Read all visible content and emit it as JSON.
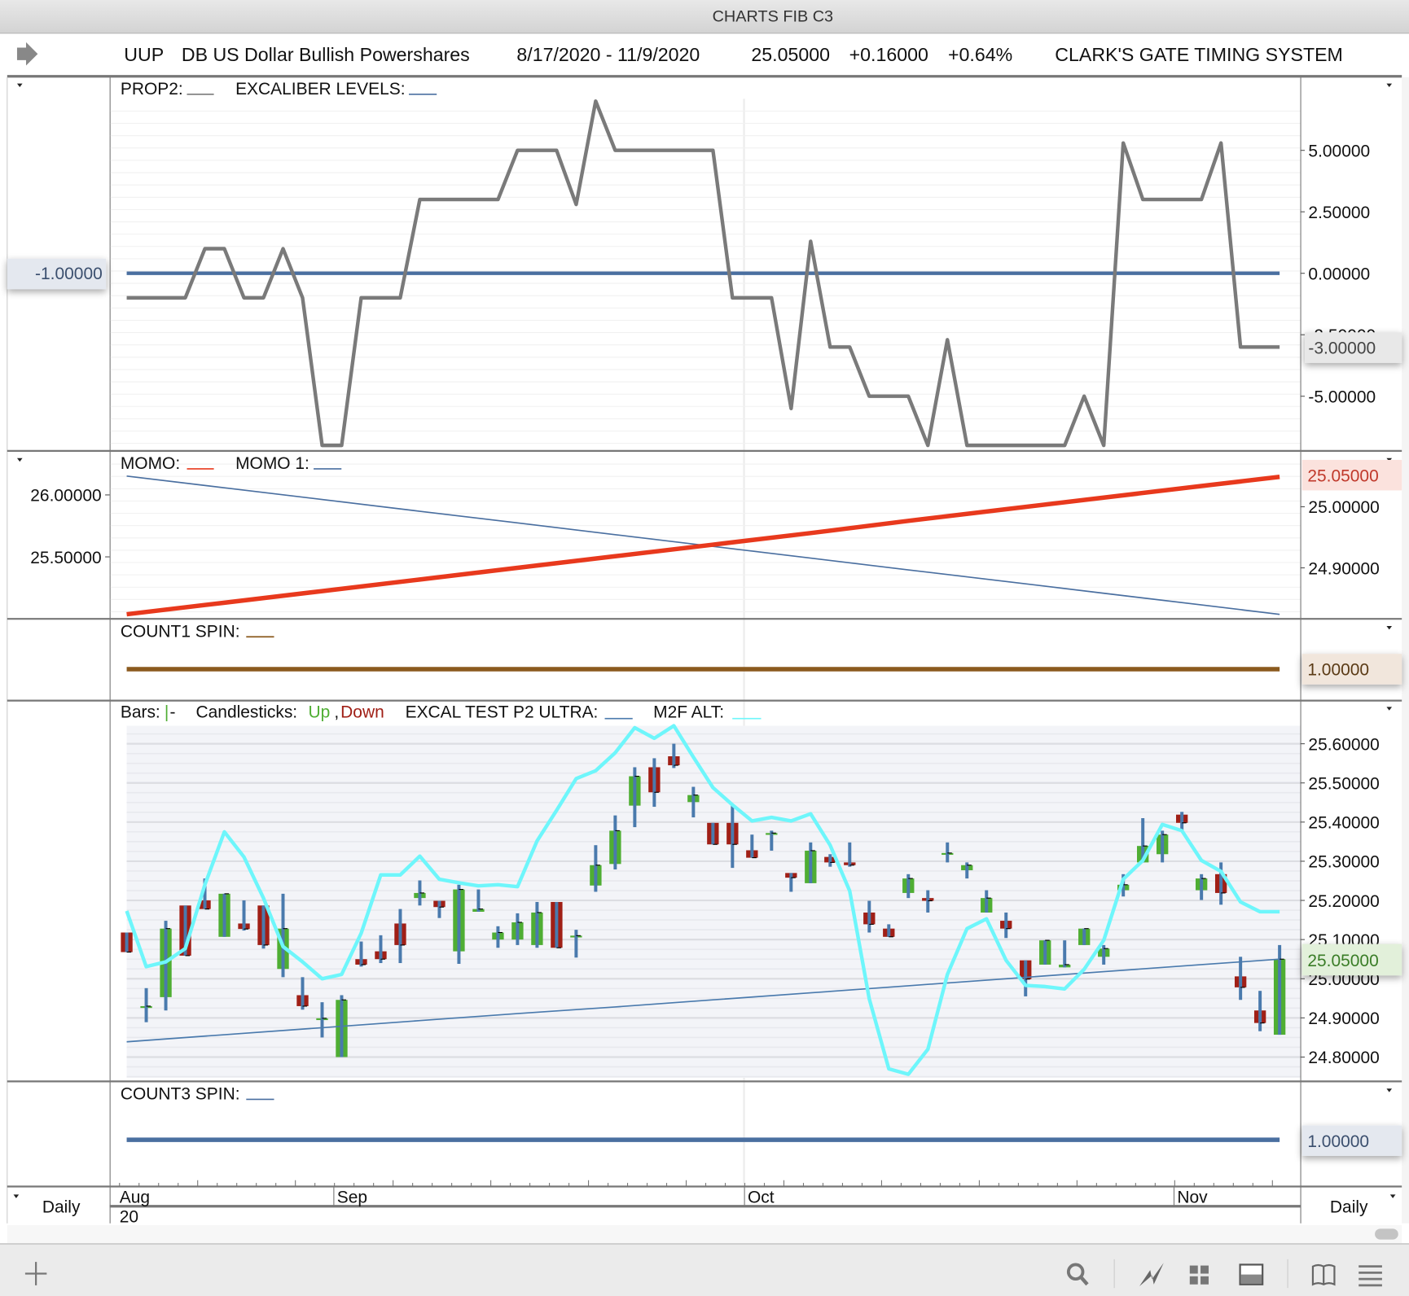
{
  "window": {
    "title": "CHARTS FIB C3"
  },
  "header": {
    "icon": "arrow-right-icon",
    "symbol": "UUP",
    "name": "DB US Dollar Bullish Powershares",
    "date_range": "8/17/2020 - 11/9/2020",
    "last": "25.05000",
    "change": "+0.16000",
    "change_pct": "+0.64%",
    "system": "CLARK'S GATE TIMING SYSTEM"
  },
  "time_axis": {
    "period_left": "Daily",
    "period_right": "Daily",
    "months": [
      "Aug",
      "Sep",
      "Oct",
      "Nov"
    ],
    "year": "20"
  },
  "toolbar": {
    "icons": [
      "add-icon",
      "search-icon",
      "chart-line-icon",
      "grid-icon",
      "panel-icon",
      "book-icon",
      "menu-icon"
    ]
  },
  "colors": {
    "up": "#4fae33",
    "down": "#a01f16",
    "bar": "#4a7aad",
    "prop2": "#7a7a7a",
    "excaliber": "#4a6fa0",
    "momo": "#e8391d",
    "momo1": "#4a6fa0",
    "count1": "#8b5a1e",
    "count3": "#4a6fa0",
    "m2f": "#6ef6fb",
    "excal_test": "#4a7aad"
  },
  "dates": [
    "2020-08-17",
    "2020-08-18",
    "2020-08-19",
    "2020-08-20",
    "2020-08-21",
    "2020-08-24",
    "2020-08-25",
    "2020-08-26",
    "2020-08-27",
    "2020-08-28",
    "2020-08-31",
    "2020-09-01",
    "2020-09-02",
    "2020-09-03",
    "2020-09-04",
    "2020-09-08",
    "2020-09-09",
    "2020-09-10",
    "2020-09-11",
    "2020-09-14",
    "2020-09-15",
    "2020-09-16",
    "2020-09-17",
    "2020-09-18",
    "2020-09-21",
    "2020-09-22",
    "2020-09-23",
    "2020-09-24",
    "2020-09-25",
    "2020-09-28",
    "2020-09-29",
    "2020-09-30",
    "2020-10-01",
    "2020-10-02",
    "2020-10-05",
    "2020-10-06",
    "2020-10-07",
    "2020-10-08",
    "2020-10-09",
    "2020-10-12",
    "2020-10-13",
    "2020-10-14",
    "2020-10-15",
    "2020-10-16",
    "2020-10-19",
    "2020-10-20",
    "2020-10-21",
    "2020-10-22",
    "2020-10-23",
    "2020-10-26",
    "2020-10-27",
    "2020-10-28",
    "2020-10-29",
    "2020-10-30",
    "2020-11-02",
    "2020-11-03",
    "2020-11-04",
    "2020-11-05",
    "2020-11-06",
    "2020-11-09"
  ],
  "chart_data": [
    {
      "type": "line",
      "legend": [
        "PROP2:",
        "EXCALIBER LEVELS:"
      ],
      "ylim": [
        -7.15,
        7.9
      ],
      "y_ticks": [
        "5.00000",
        "2.50000",
        "0.00000",
        "-2.50000",
        "-5.00000"
      ],
      "y_tick_values": [
        5,
        2.5,
        0,
        -2.5,
        -5
      ],
      "left_marker": "-1.00000",
      "right_marker": "-3.00000",
      "series": [
        {
          "name": "PROP2",
          "values": [
            -1,
            -1,
            -1,
            -1,
            1,
            1,
            -1,
            -1,
            1,
            -1,
            -7,
            -7,
            -1,
            -1,
            -1,
            3,
            3,
            3,
            3,
            3,
            5,
            5,
            5,
            2.8,
            7,
            5,
            5,
            5,
            5,
            5,
            5,
            -1,
            -1,
            -1,
            -5.5,
            1.3,
            -3,
            -3,
            -5,
            -5,
            -5,
            -7,
            -2.7,
            -7,
            -7,
            -7,
            -7,
            -7,
            -7,
            -5,
            -7,
            5.3,
            3,
            3,
            3,
            3,
            5.3,
            -3,
            -3,
            -3
          ]
        },
        {
          "name": "EXCALIBER LEVELS",
          "level": 0
        }
      ]
    },
    {
      "type": "line",
      "legend": [
        "MOMO:",
        "MOMO 1:"
      ],
      "right_ylim": [
        24.818,
        25.09
      ],
      "left_ylim": [
        25.007,
        26.348
      ],
      "right_ticks": [
        "25.00000",
        "24.90000"
      ],
      "right_tick_values": [
        25.0,
        24.9
      ],
      "left_ticks": [
        "26.00000",
        "25.50000"
      ],
      "left_tick_values": [
        26.0,
        25.5
      ],
      "right_marker": "25.05000",
      "x": [
        "2020-08-17",
        "2020-08-24",
        "2020-08-31",
        "2020-09-08",
        "2020-09-15",
        "2020-09-22",
        "2020-09-29",
        "2020-10-06",
        "2020-10-13",
        "2020-10-20",
        "2020-10-27",
        "2020-11-03",
        "2020-11-09"
      ],
      "series": [
        {
          "name": "MOMO",
          "axis": "right",
          "values": [
            24.824,
            24.843,
            24.862,
            24.881,
            24.9,
            24.919,
            24.938,
            24.957,
            24.977,
            24.996,
            25.015,
            25.034,
            25.049
          ]
        },
        {
          "name": "MOMO 1",
          "axis": "left",
          "values": [
            26.152,
            26.057,
            25.963,
            25.868,
            25.774,
            25.679,
            25.585,
            25.49,
            25.395,
            25.301,
            25.206,
            25.112,
            25.036
          ]
        }
      ]
    },
    {
      "type": "line",
      "legend": [
        "COUNT1 SPIN:"
      ],
      "right_marker": "1.00000",
      "series": [
        {
          "name": "COUNT1 SPIN",
          "level": 1
        }
      ]
    },
    {
      "type": "candlestick",
      "legend": {
        "bars": "Bars:",
        "bars_glyph_a": "|",
        "bars_glyph_b": "-",
        "candles": "Candlesticks:",
        "up": "Up",
        "sep": ",",
        "down": "Down",
        "excal": "EXCAL TEST P2 ULTRA:",
        "m2f": "M2F ALT:"
      },
      "ylim": [
        24.747,
        25.646
      ],
      "y_ticks": [
        "25.60000",
        "25.50000",
        "25.40000",
        "25.30000",
        "25.20000",
        "25.10000",
        "25.00000",
        "24.90000",
        "24.80000"
      ],
      "y_tick_values": [
        25.6,
        25.5,
        25.4,
        25.3,
        25.2,
        25.1,
        25.0,
        24.9,
        24.8
      ],
      "right_marker": "25.05000",
      "ohlc": [
        [
          25.118,
          25.118,
          25.068,
          25.068
        ],
        [
          24.926,
          24.976,
          24.889,
          24.93
        ],
        [
          24.953,
          25.148,
          24.919,
          25.128
        ],
        [
          25.187,
          25.187,
          25.059,
          25.059
        ],
        [
          25.2,
          25.256,
          25.178,
          25.178
        ],
        [
          25.107,
          25.217,
          25.107,
          25.217
        ],
        [
          25.141,
          25.2,
          25.123,
          25.127
        ],
        [
          25.187,
          25.187,
          25.077,
          25.086
        ],
        [
          25.025,
          25.217,
          25.004,
          25.128
        ],
        [
          24.958,
          25.004,
          24.921,
          24.93
        ],
        [
          24.898,
          24.94,
          24.85,
          24.899
        ],
        [
          24.8,
          24.958,
          24.8,
          24.946
        ],
        [
          25.05,
          25.095,
          25.031,
          25.036
        ],
        [
          25.07,
          25.111,
          25.04,
          25.05
        ],
        [
          25.141,
          25.178,
          25.04,
          25.086
        ],
        [
          25.206,
          25.251,
          25.187,
          25.219
        ],
        [
          25.199,
          25.199,
          25.155,
          25.183
        ],
        [
          25.07,
          25.24,
          25.038,
          25.228
        ],
        [
          25.171,
          25.228,
          25.171,
          25.178
        ],
        [
          25.1,
          25.134,
          25.079,
          25.118
        ],
        [
          25.1,
          25.167,
          25.086,
          25.144
        ],
        [
          25.086,
          25.196,
          25.079,
          25.169
        ],
        [
          25.196,
          25.196,
          25.079,
          25.079
        ],
        [
          25.109,
          25.125,
          25.054,
          25.11
        ],
        [
          25.238,
          25.341,
          25.222,
          25.29
        ],
        [
          25.293,
          25.417,
          25.279,
          25.378
        ],
        [
          25.442,
          25.54,
          25.387,
          25.517
        ],
        [
          25.54,
          25.563,
          25.439,
          25.476
        ],
        [
          25.568,
          25.6,
          25.538,
          25.545
        ],
        [
          25.451,
          25.49,
          25.412,
          25.469
        ],
        [
          25.398,
          25.398,
          25.343,
          25.343
        ],
        [
          25.398,
          25.444,
          25.283,
          25.343
        ],
        [
          25.328,
          25.368,
          25.309,
          25.309
        ],
        [
          25.371,
          25.378,
          25.327,
          25.372
        ],
        [
          25.27,
          25.27,
          25.222,
          25.258
        ],
        [
          25.244,
          25.348,
          25.244,
          25.327
        ],
        [
          25.311,
          25.318,
          25.286,
          25.297
        ],
        [
          25.297,
          25.348,
          25.286,
          25.29
        ],
        [
          25.169,
          25.199,
          25.118,
          25.139
        ],
        [
          25.128,
          25.139,
          25.107,
          25.107
        ],
        [
          25.219,
          25.267,
          25.206,
          25.256
        ],
        [
          25.206,
          25.226,
          25.169,
          25.199
        ],
        [
          25.32,
          25.348,
          25.297,
          25.321
        ],
        [
          25.277,
          25.297,
          25.256,
          25.29
        ],
        [
          25.169,
          25.226,
          25.169,
          25.206
        ],
        [
          25.148,
          25.169,
          25.104,
          25.128
        ],
        [
          25.047,
          25.047,
          24.955,
          24.999
        ],
        [
          25.036,
          25.098,
          25.036,
          25.098
        ],
        [
          25.029,
          25.098,
          25.029,
          25.036
        ],
        [
          25.086,
          25.128,
          25.086,
          25.128
        ],
        [
          25.056,
          25.086,
          25.036,
          25.077
        ],
        [
          25.226,
          25.267,
          25.21,
          25.24
        ],
        [
          25.297,
          25.41,
          25.297,
          25.339
        ],
        [
          25.318,
          25.378,
          25.297,
          25.368
        ],
        [
          25.419,
          25.426,
          25.378,
          25.398
        ],
        [
          25.226,
          25.267,
          25.201,
          25.256
        ],
        [
          25.267,
          25.297,
          25.189,
          25.219
        ],
        [
          25.006,
          25.056,
          24.946,
          24.978
        ],
        [
          24.919,
          24.969,
          24.866,
          24.887
        ],
        [
          24.857,
          25.086,
          24.857,
          25.05
        ]
      ],
      "series": [
        {
          "name": "M2F ALT",
          "values": [
            25.173,
            25.031,
            25.043,
            25.077,
            25.24,
            25.375,
            25.311,
            25.206,
            25.082,
            25.043,
            25.0,
            25.011,
            25.116,
            25.265,
            25.265,
            25.313,
            25.254,
            25.245,
            25.237,
            25.24,
            25.235,
            25.352,
            25.43,
            25.511,
            25.531,
            25.577,
            25.641,
            25.614,
            25.646,
            25.566,
            25.488,
            25.444,
            25.403,
            25.412,
            25.403,
            25.421,
            25.341,
            25.224,
            24.949,
            24.77,
            24.756,
            24.82,
            25.011,
            25.128,
            25.153,
            25.047,
            24.983,
            24.98,
            24.974,
            25.024,
            25.098,
            25.254,
            25.302,
            25.394,
            25.378,
            25.302,
            25.274,
            25.196,
            25.171,
            25.171
          ]
        },
        {
          "name": "EXCAL TEST P2 ULTRA",
          "x": [
            "2020-08-17",
            "2020-08-24",
            "2020-08-31",
            "2020-09-08",
            "2020-09-15",
            "2020-09-22",
            "2020-09-29",
            "2020-10-06",
            "2020-10-13",
            "2020-10-20",
            "2020-10-27",
            "2020-11-03",
            "2020-11-09"
          ],
          "values": [
            24.839,
            24.857,
            24.875,
            24.893,
            24.911,
            24.928,
            24.946,
            24.964,
            24.982,
            25.0,
            25.018,
            25.036,
            25.05
          ]
        }
      ]
    },
    {
      "type": "line",
      "legend": [
        "COUNT3 SPIN:"
      ],
      "right_marker": "1.00000",
      "series": [
        {
          "name": "COUNT3 SPIN",
          "level": 1
        }
      ]
    }
  ]
}
